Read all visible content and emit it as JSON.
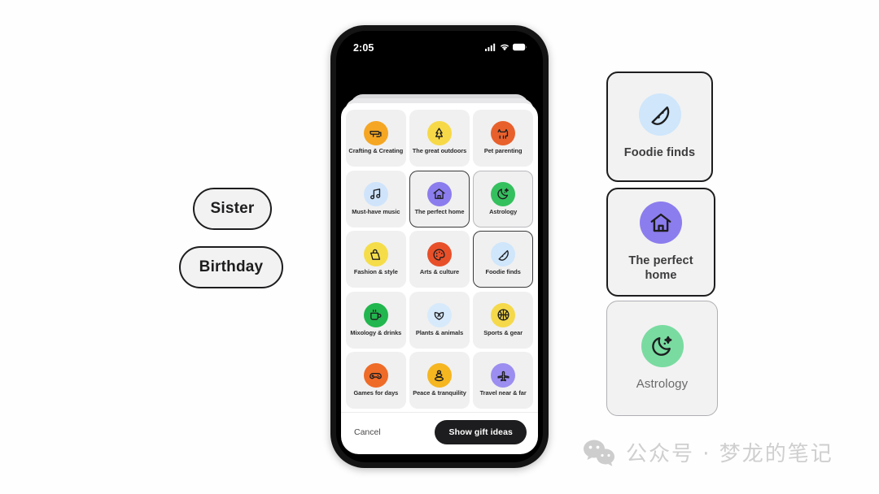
{
  "background_color": "#ffffff",
  "prompt_pills": [
    {
      "label": "Sister",
      "name": "pill-sister"
    },
    {
      "label": "Birthday",
      "name": "pill-birthday"
    }
  ],
  "phone": {
    "status_bar": {
      "time": "2:05",
      "icons": [
        "cellular-signal-icon",
        "wifi-icon",
        "battery-icon"
      ]
    },
    "sheet": {
      "tiles": [
        {
          "label": "Crafting & Creating",
          "icon": "sewing-machine-icon",
          "color": "#f5a623",
          "selected": "none"
        },
        {
          "label": "The great outdoors",
          "icon": "tree-icon",
          "color": "#f7d948",
          "selected": "none"
        },
        {
          "label": "Pet parenting",
          "icon": "dog-icon",
          "color": "#e8602c",
          "selected": "none"
        },
        {
          "label": "Must-have music",
          "icon": "music-note-icon",
          "color": "#cfe4fb",
          "selected": "none"
        },
        {
          "label": "The perfect home",
          "icon": "house-icon",
          "color": "#8c7dee",
          "selected": "strong"
        },
        {
          "label": "Astrology",
          "icon": "moon-stars-icon",
          "color": "#35c05e",
          "selected": "light"
        },
        {
          "label": "Fashion & style",
          "icon": "handbag-icon",
          "color": "#f5dd4a",
          "selected": "none"
        },
        {
          "label": "Arts & culture",
          "icon": "paint-palette-icon",
          "color": "#e8502a",
          "selected": "none"
        },
        {
          "label": "Foodie finds",
          "icon": "pizza-slice-icon",
          "color": "#cfe6fb",
          "selected": "strong"
        },
        {
          "label": "Mixology & drinks",
          "icon": "mug-icon",
          "color": "#22b64e",
          "selected": "none"
        },
        {
          "label": "Plants & animals",
          "icon": "leaves-icon",
          "color": "#d7eafb",
          "selected": "none"
        },
        {
          "label": "Sports & gear",
          "icon": "basketball-icon",
          "color": "#f5d94a",
          "selected": "none"
        },
        {
          "label": "Games for days",
          "icon": "gamepad-icon",
          "color": "#ef6b28",
          "selected": "none"
        },
        {
          "label": "Peace & tranquility",
          "icon": "stacked-stones-icon",
          "color": "#f5b620",
          "selected": "none"
        },
        {
          "label": "Travel near & far",
          "icon": "airplane-icon",
          "color": "#9b8ef0",
          "selected": "none"
        }
      ],
      "footer": {
        "cancel_label": "Cancel",
        "submit_label": "Show gift ideas",
        "submit_bg": "#1d1d1f"
      }
    }
  },
  "selected_cards": [
    {
      "label": "Foodie finds",
      "icon": "pizza-slice-icon",
      "color": "#cfe6fb",
      "border": "strong"
    },
    {
      "label": "The perfect home",
      "icon": "house-icon",
      "color": "#8c7dee",
      "border": "strong"
    },
    {
      "label": "Astrology",
      "icon": "moon-stars-icon",
      "color": "#79dba0",
      "border": "light"
    }
  ],
  "watermark": {
    "icon": "wechat-icon",
    "text": "公众号 · 梦龙的笔记"
  }
}
